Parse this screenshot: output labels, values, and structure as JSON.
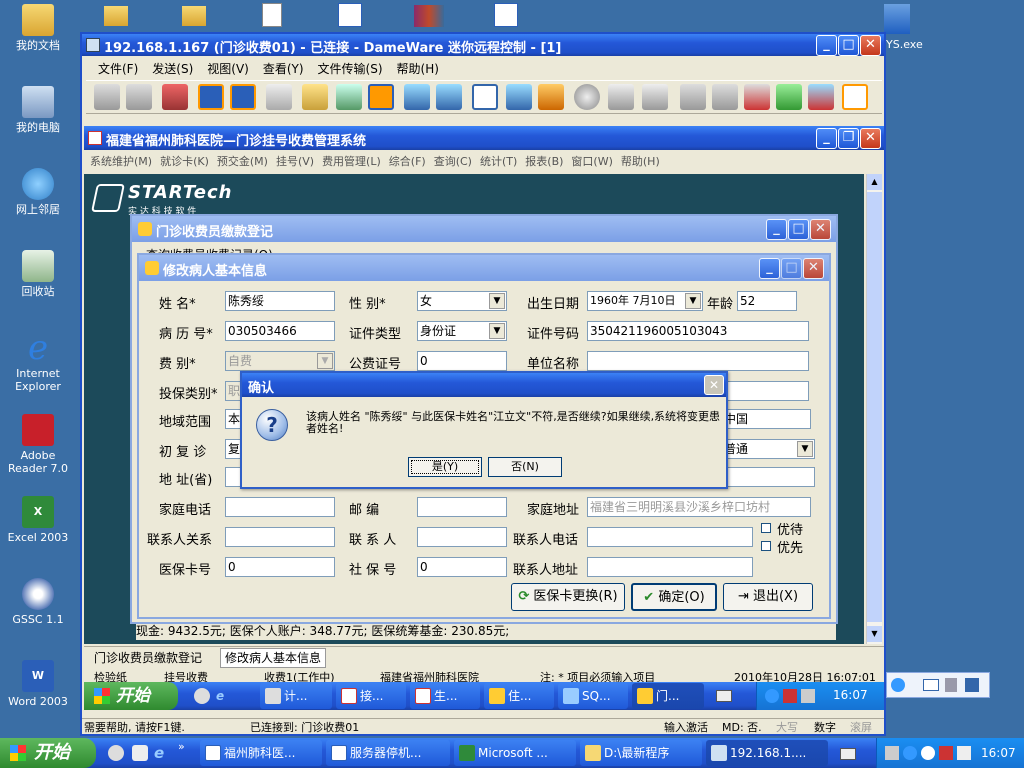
{
  "desktop_icons": [
    {
      "name": "my-documents",
      "label": "我的文档",
      "color": "#e8c34a"
    },
    {
      "name": "my-computer",
      "label": "我的电脑",
      "color": "#9fb7d9"
    },
    {
      "name": "network-places",
      "label": "网上邻居",
      "color": "#4aa0d8"
    },
    {
      "name": "recycle-bin",
      "label": "回收站",
      "color": "#7fb87a"
    },
    {
      "name": "internet-explorer",
      "label": "Internet Explorer",
      "color": "#2f7fe0"
    },
    {
      "name": "adobe-reader",
      "label": "Adobe Reader 7.0",
      "color": "#c8202a"
    },
    {
      "name": "excel-2003",
      "label": "Excel 2003",
      "color": "#2f8a3a"
    },
    {
      "name": "gssc",
      "label": "GSSC 1.1",
      "color": "#5a7ab8"
    },
    {
      "name": "word-2003",
      "label": "Word 2003",
      "color": "#2b5fb8"
    }
  ],
  "desktop_right_label": "YS.exe",
  "dameware": {
    "title": "192.168.1.167 (门诊收费01) - 已连接 - DameWare 迷你远程控制 - [1]",
    "menu": [
      "文件(F)",
      "发送(S)",
      "视图(V)",
      "查看(Y)",
      "文件传输(S)",
      "帮助(H)"
    ],
    "status_help": "需要帮助, 请按F1键.",
    "status_conn": "已连接到: 门诊收费01",
    "status_ime": "输入激活",
    "status_md": "MD: 否.",
    "status_caps": "大写",
    "status_num": "数字",
    "status_scroll": "滚屏"
  },
  "his": {
    "title": "福建省福州肺科医院—门诊挂号收费管理系统",
    "menu": [
      "系统维护(M)",
      "就诊卡(K)",
      "预交金(M)",
      "挂号(V)",
      "费用管理(L)",
      "综合(F)",
      "查询(C)",
      "统计(T)",
      "报表(B)",
      "窗口(W)",
      "帮助(H)"
    ],
    "logo_brand": "STARTech",
    "logo_sub": "实 达 科 技 软 件",
    "info_line": "现金: 9432.5元; 医保个人账户: 348.77元; 医保统筹基金: 230.85元;",
    "tabs": [
      "门诊收费员缴款登记",
      "修改病人基本信息"
    ],
    "bottom_row": [
      "检验纸",
      "挂号收费",
      "收费1(工作中)",
      "福建省福州肺科医院",
      "注: * 项目必须输入项目",
      "2010年10月28日 16:07:01"
    ]
  },
  "payment_window": {
    "title": "门诊收费员缴款登记",
    "partial": "查询收费员收费记录(Q)"
  },
  "patient_form": {
    "title": "修改病人基本信息",
    "name_label": "姓    名*",
    "name": "陈秀绥",
    "sex_label": "性    别*",
    "sex": "女",
    "birth_label": "出生日期",
    "birth": "1960年 7月10日",
    "age_label": "年龄",
    "age": "52",
    "record_label": "病 历 号*",
    "record": "030503466",
    "idtype_label": "证件类型",
    "idtype": "身份证",
    "idno_label": "证件号码",
    "idno": "350421196005103043",
    "fee_label": "费    别*",
    "fee": "自费",
    "pubno_label": "公费证号",
    "pubno": "0",
    "unit_label": "单位名称",
    "unit": "",
    "ins_label": "投保类别*",
    "ins": "职工",
    "region_label": "地域范围",
    "region": "本",
    "region_right": "中国",
    "visit_label": "初 复 诊",
    "visit": "复",
    "visit_right": "普通",
    "addr_label": "地 址(省)",
    "addr": "",
    "phone_label": "家庭电话",
    "phone": "",
    "zip_label": "邮    编",
    "zip": "",
    "home_label": "家庭地址",
    "home": "福建省三明明溪县沙溪乡梓口坊村",
    "rel_label": "联系人关系",
    "rel": "",
    "contact_label": "联 系 人",
    "contact": "",
    "cphone_label": "联系人电话",
    "cphone": "",
    "priority": "优待",
    "first": "优先",
    "card_label": "医保卡号",
    "card": "0",
    "social_label": "社 保 号",
    "social": "0",
    "caddr_label": "联系人地址",
    "caddr": "",
    "btn_change": "医保卡更换(R)",
    "btn_ok": "确定(O)",
    "btn_exit": "退出(X)"
  },
  "dialog": {
    "title": "确认",
    "message": "该病人姓名 \"陈秀绥\" 与此医保卡姓名\"江立文\"不符,是否继续?如果继续,系统将变更患者姓名!",
    "yes": "是(Y)",
    "no": "否(N)"
  },
  "inner_taskbar": {
    "start": "开始",
    "items": [
      "计...",
      "接...",
      "生...",
      "住...",
      "SQ...",
      "门..."
    ],
    "time": "16:07"
  },
  "outer_taskbar": {
    "start": "开始",
    "items": [
      "福州肺科医...",
      "服务器停机...",
      "Microsoft ...",
      "D:\\最新程序",
      "192.168.1...."
    ],
    "time": "16:07"
  }
}
